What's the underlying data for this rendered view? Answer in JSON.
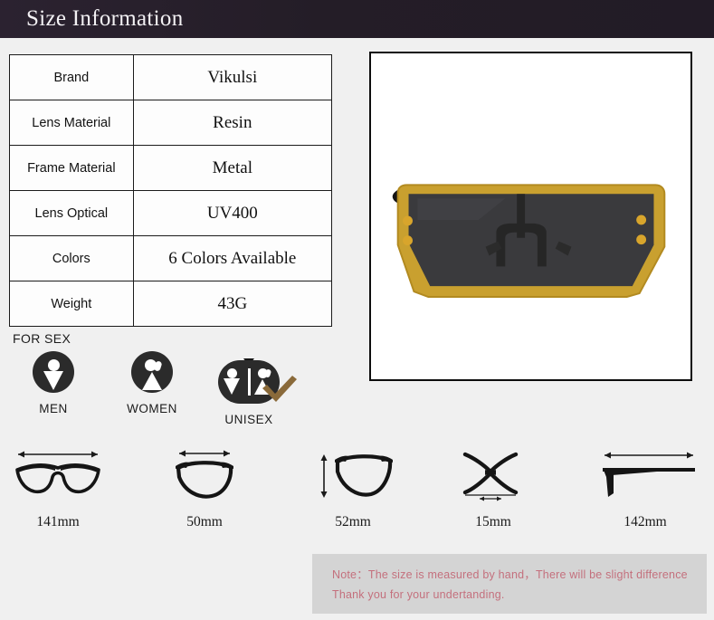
{
  "header": {
    "title": "Size Information",
    "background_color": "#241d27",
    "text_color": "#f3f1f4"
  },
  "spec_table": {
    "rows": [
      {
        "label": "Brand",
        "value": "Vikulsi"
      },
      {
        "label": "Lens Material",
        "value": "Resin"
      },
      {
        "label": "Frame Material",
        "value": "Metal"
      },
      {
        "label": "Lens Optical",
        "value": "UV400"
      },
      {
        "label": "Colors",
        "value": "6 Colors Available"
      },
      {
        "label": "Weight",
        "value": "43G"
      }
    ]
  },
  "gender": {
    "section_label": "FOR SEX",
    "selected": "UNISEX",
    "badge_color": "#2b2b2b",
    "check_color": "#8a6a3a",
    "options": [
      {
        "caption": "MEN",
        "icon": "male-figure-icon"
      },
      {
        "caption": "WOMEN",
        "icon": "female-figure-icon"
      },
      {
        "caption": "UNISEX",
        "icon": "unisex-figures-icon"
      }
    ]
  },
  "measurements": [
    {
      "label": "141mm",
      "icon": "full-frame-width-icon",
      "description": "total frame width"
    },
    {
      "label": "50mm",
      "icon": "lens-width-icon",
      "description": "lens width"
    },
    {
      "label": "52mm",
      "icon": "lens-height-icon",
      "description": "lens height"
    },
    {
      "label": "15mm",
      "icon": "bridge-width-icon",
      "description": "bridge width"
    },
    {
      "label": "142mm",
      "icon": "temple-length-icon",
      "description": "temple arm length"
    }
  ],
  "product_image": {
    "alt": "oversized gold-frame shield sunglasses",
    "frame_color": "#c9a02f",
    "lens_color": "#3a3a3d",
    "temple_color": "#1e1e1e",
    "rivet_color": "#d8a52c",
    "background": "#ffffff"
  },
  "note": {
    "line1": "Note：The size is measured by hand，There will be slight difference",
    "line2": "Thank you for your undertanding.",
    "text_color": "#c4707d",
    "background_color": "#d4d4d4"
  }
}
